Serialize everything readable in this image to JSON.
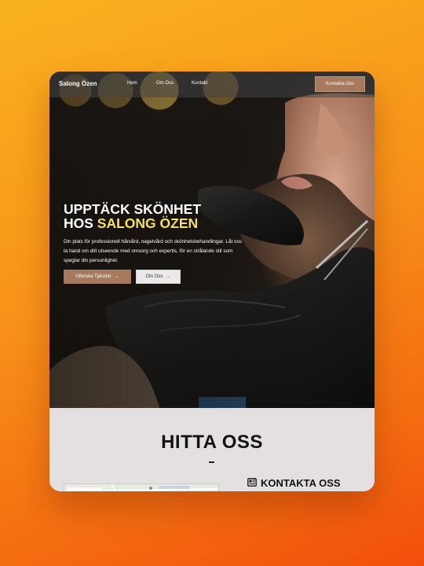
{
  "nav": {
    "brand": "Salong Özen",
    "links": [
      "Hem",
      "Om Oss",
      "Kontakt"
    ],
    "cta": "Kontakta Oss"
  },
  "hero": {
    "title_line1": "UPPTÄCK SKÖNHET",
    "title_line2_prefix": "HOS ",
    "title_line2_highlight": "SALONG ÖZEN",
    "description": "Din plats för professionell hårvård, nagelvård och skönhetsbehandlingar. Låt oss ta hand om ditt utseende med omsorg och expertis, för en strålande stil som speglar din personlighet.",
    "primary_button": "Utforska Tjänster",
    "secondary_button": "Om Oss",
    "arrow": "→"
  },
  "find": {
    "title": "HITTA OSS",
    "contact_heading": "KONTAKTA OSS"
  },
  "colors": {
    "accent": "#a57a5e",
    "highlight": "#f6df67",
    "background_gradient_start": "#f9b21f",
    "background_gradient_end": "#f24e0c"
  }
}
